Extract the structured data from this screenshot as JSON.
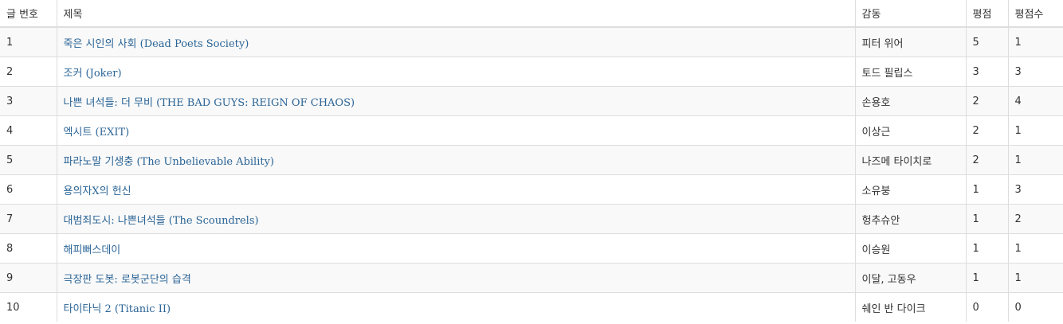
{
  "headers": {
    "no": "글 번호",
    "title": "제목",
    "director": "감동",
    "score": "평점",
    "count": "평점수"
  },
  "rows": [
    {
      "no": "1",
      "title": "죽은 시인의 사회 (Dead Poets Society)",
      "director": "피터 위어",
      "score": "5",
      "count": "1"
    },
    {
      "no": "2",
      "title": "조커 (Joker)",
      "director": "토드 필립스",
      "score": "3",
      "count": "3"
    },
    {
      "no": "3",
      "title": "나쁜 녀석들: 더 무비 (THE BAD GUYS: REIGN OF CHAOS)",
      "director": "손용호",
      "score": "2",
      "count": "4"
    },
    {
      "no": "4",
      "title": "엑시트 (EXIT)",
      "director": "이상근",
      "score": "2",
      "count": "1"
    },
    {
      "no": "5",
      "title": "파라노말 기생충 (The Unbelievable Ability)",
      "director": "나즈메 타이치로",
      "score": "2",
      "count": "1"
    },
    {
      "no": "6",
      "title": "용의자X의 헌신",
      "director": "소유붕",
      "score": "1",
      "count": "3"
    },
    {
      "no": "7",
      "title": "대범죄도시: 나쁜녀석들 (The Scoundrels)",
      "director": "헝추슈안",
      "score": "1",
      "count": "2"
    },
    {
      "no": "8",
      "title": "해피뻐스데이",
      "director": "이승원",
      "score": "1",
      "count": "1"
    },
    {
      "no": "9",
      "title": "극장판 도봇: 로봇군단의 습격",
      "director": "이달, 고동우",
      "score": "1",
      "count": "1"
    },
    {
      "no": "10",
      "title": "타이타닉 2 (Titanic II)",
      "director": "쉐인 반 다이크",
      "score": "0",
      "count": "0"
    }
  ]
}
